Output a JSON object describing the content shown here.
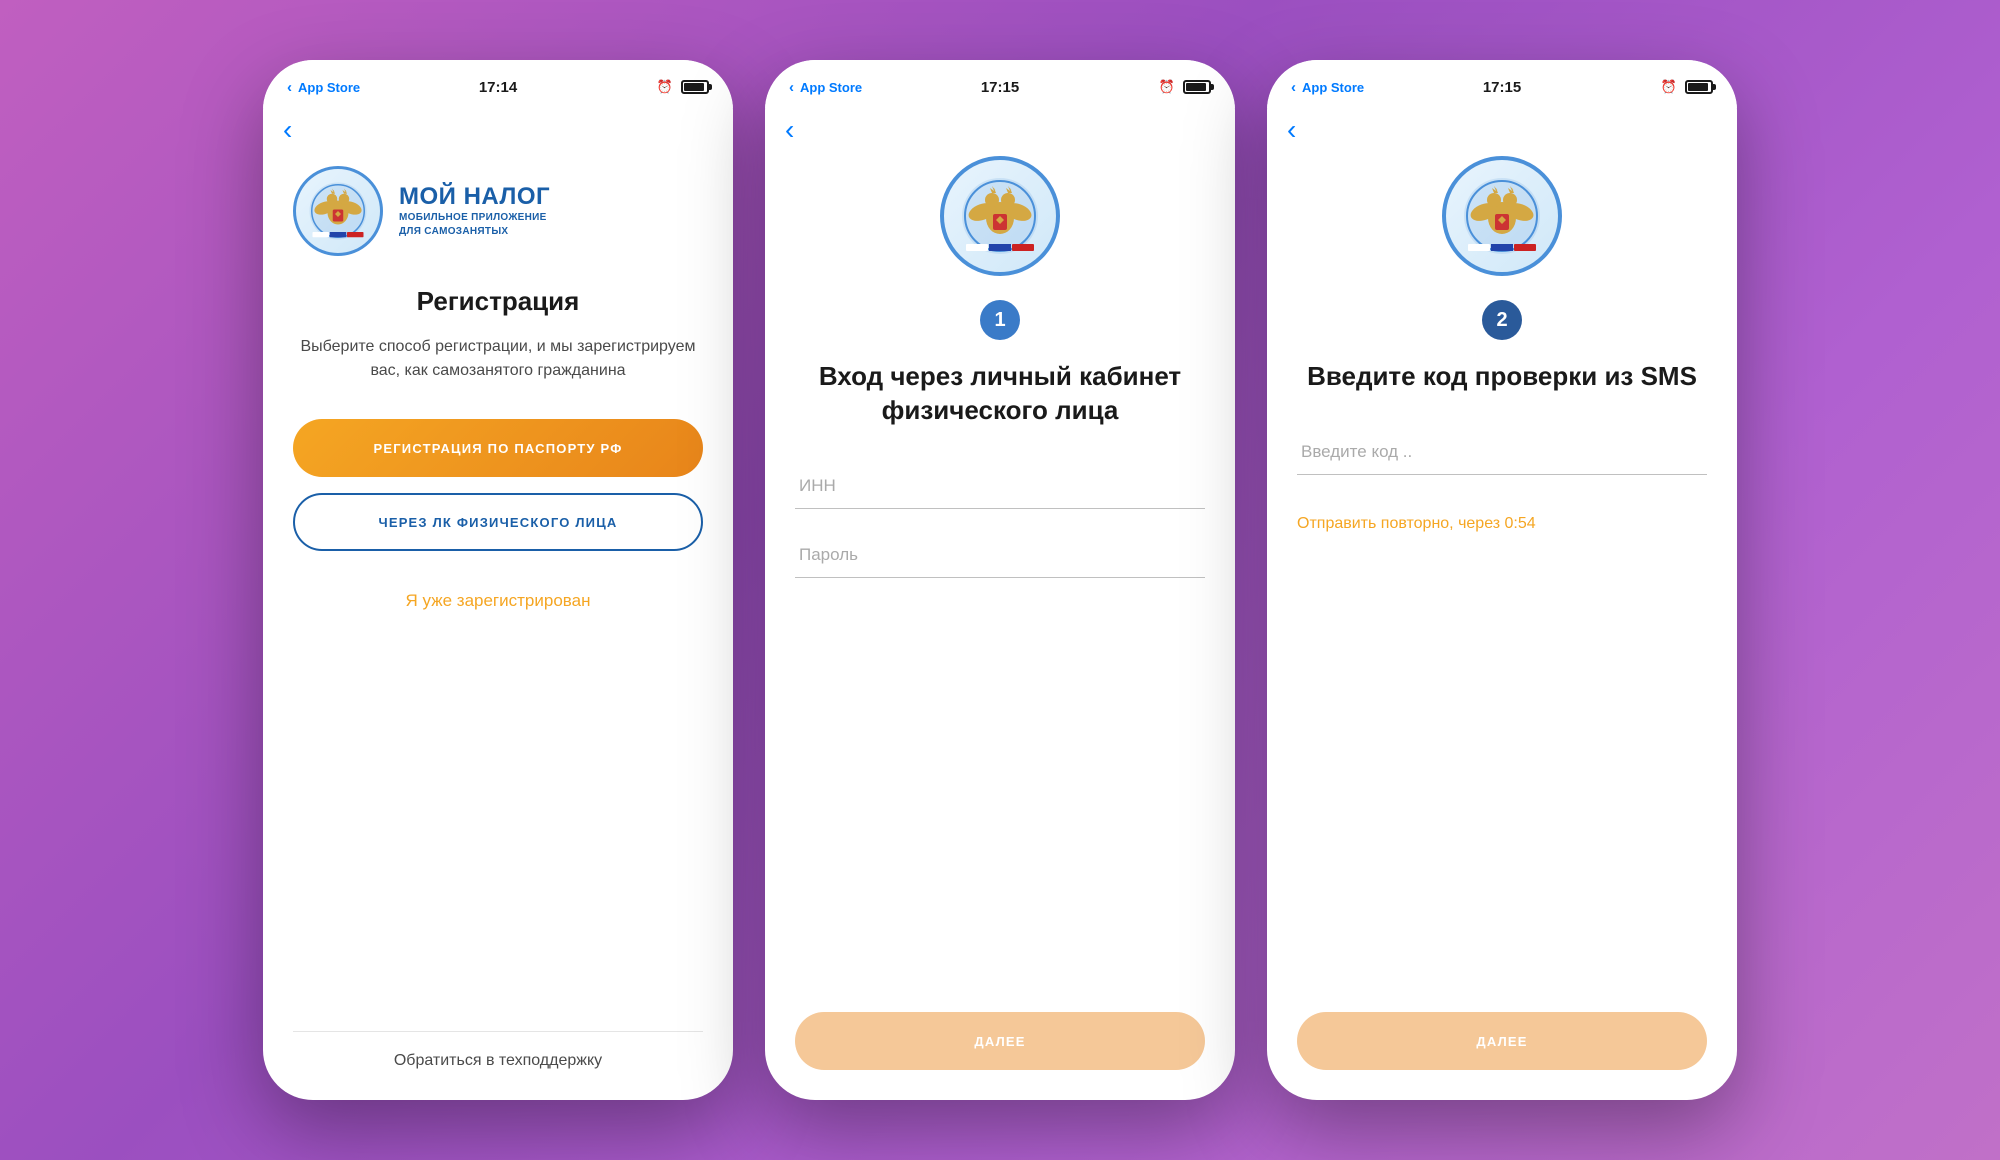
{
  "background": "#b060c8",
  "screens": [
    {
      "id": "registration",
      "status_bar": {
        "left": "App Store",
        "time": "17:14",
        "signal_bars": [
          3,
          5,
          7,
          9,
          11
        ]
      },
      "logo": {
        "title": "МОЙ НАЛОГ",
        "subtitle_line1": "МОБИЛЬНОЕ ПРИЛОЖЕНИЕ",
        "subtitle_line2": "ДЛЯ САМОЗАНЯТЫХ"
      },
      "title": "Регистрация",
      "description": "Выберите способ регистрации,\nи мы зарегистрируем вас, как\nсамозанятого гражданина",
      "btn_passport": "РЕГИСТРАЦИЯ ПО ПАСПОРТУ РФ",
      "btn_lk": "ЧЕРЕЗ ЛК ФИЗИЧЕСКОГО ЛИЦА",
      "link_registered": "Я уже зарегистрирован",
      "bottom_link": "Обратиться в техподдержку"
    },
    {
      "id": "login",
      "status_bar": {
        "left": "App Store",
        "time": "17:15"
      },
      "step_number": "1",
      "title": "Вход через\nличный кабинет\nфизического лица",
      "inn_placeholder": "ИНН",
      "password_placeholder": "Пароль",
      "btn_next": "ДАЛЕЕ"
    },
    {
      "id": "sms",
      "status_bar": {
        "left": "App Store",
        "time": "17:15"
      },
      "step_number": "2",
      "title": "Введите код\nпроверки из SMS",
      "code_placeholder": "Введите код ..",
      "resend_text": "Отправить повторно, через 0:54",
      "btn_next": "ДАЛЕЕ"
    }
  ]
}
